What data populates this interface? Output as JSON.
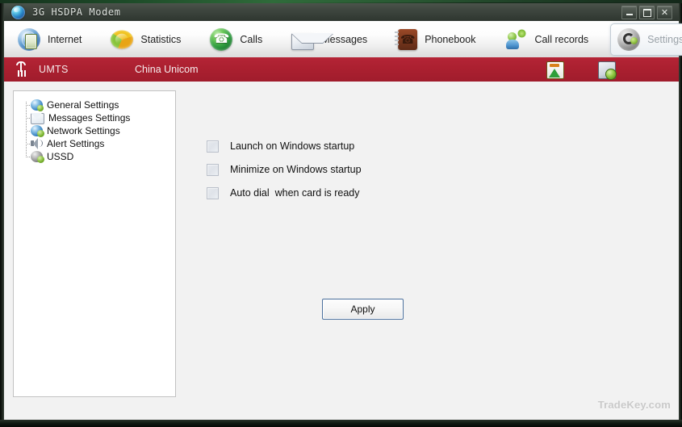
{
  "window": {
    "title": "3G HSDPA Modem",
    "icon": "globe-icon",
    "minimize_label": "",
    "maximize_label": "",
    "close_label": "✕"
  },
  "toolbar": {
    "items": [
      {
        "label": "Internet",
        "icon": "globe-phone-icon",
        "active": false
      },
      {
        "label": "Statistics",
        "icon": "pie-chart-icon",
        "active": false
      },
      {
        "label": "Calls",
        "icon": "phone-green-icon",
        "active": false
      },
      {
        "label": "Messages",
        "icon": "envelope-icon",
        "active": false
      },
      {
        "label": "Phonebook",
        "icon": "address-book-icon",
        "active": false
      },
      {
        "label": "Call records",
        "icon": "contact-log-icon",
        "active": false
      },
      {
        "label": "Settings",
        "icon": "gear-icon",
        "active": true
      }
    ]
  },
  "statusbar": {
    "network_mode": "UMTS",
    "carrier": "China Unicom",
    "signal_icon": "antenna-signal-icon",
    "icons": [
      {
        "name": "signal-strength-icon"
      },
      {
        "name": "connection-status-icon"
      }
    ],
    "color": "#ab2030"
  },
  "tree": {
    "items": [
      {
        "label": "General Settings",
        "icon": "general-settings-icon",
        "selected": false
      },
      {
        "label": "Messages Settings",
        "icon": "messages-settings-icon",
        "selected": false
      },
      {
        "label": "Network Settings",
        "icon": "network-settings-icon",
        "selected": false
      },
      {
        "label": "Alert Settings",
        "icon": "alert-settings-icon",
        "selected": false
      },
      {
        "label": "USSD",
        "icon": "ussd-icon",
        "selected": false
      }
    ]
  },
  "main": {
    "options": [
      {
        "label": "Launch on Windows startup",
        "checked": false
      },
      {
        "label": "Minimize on Windows startup",
        "checked": false
      },
      {
        "label": "Auto dial  when card is ready",
        "checked": false
      }
    ],
    "apply_label": "Apply"
  },
  "watermark": {
    "text": "TradeKey.com"
  }
}
